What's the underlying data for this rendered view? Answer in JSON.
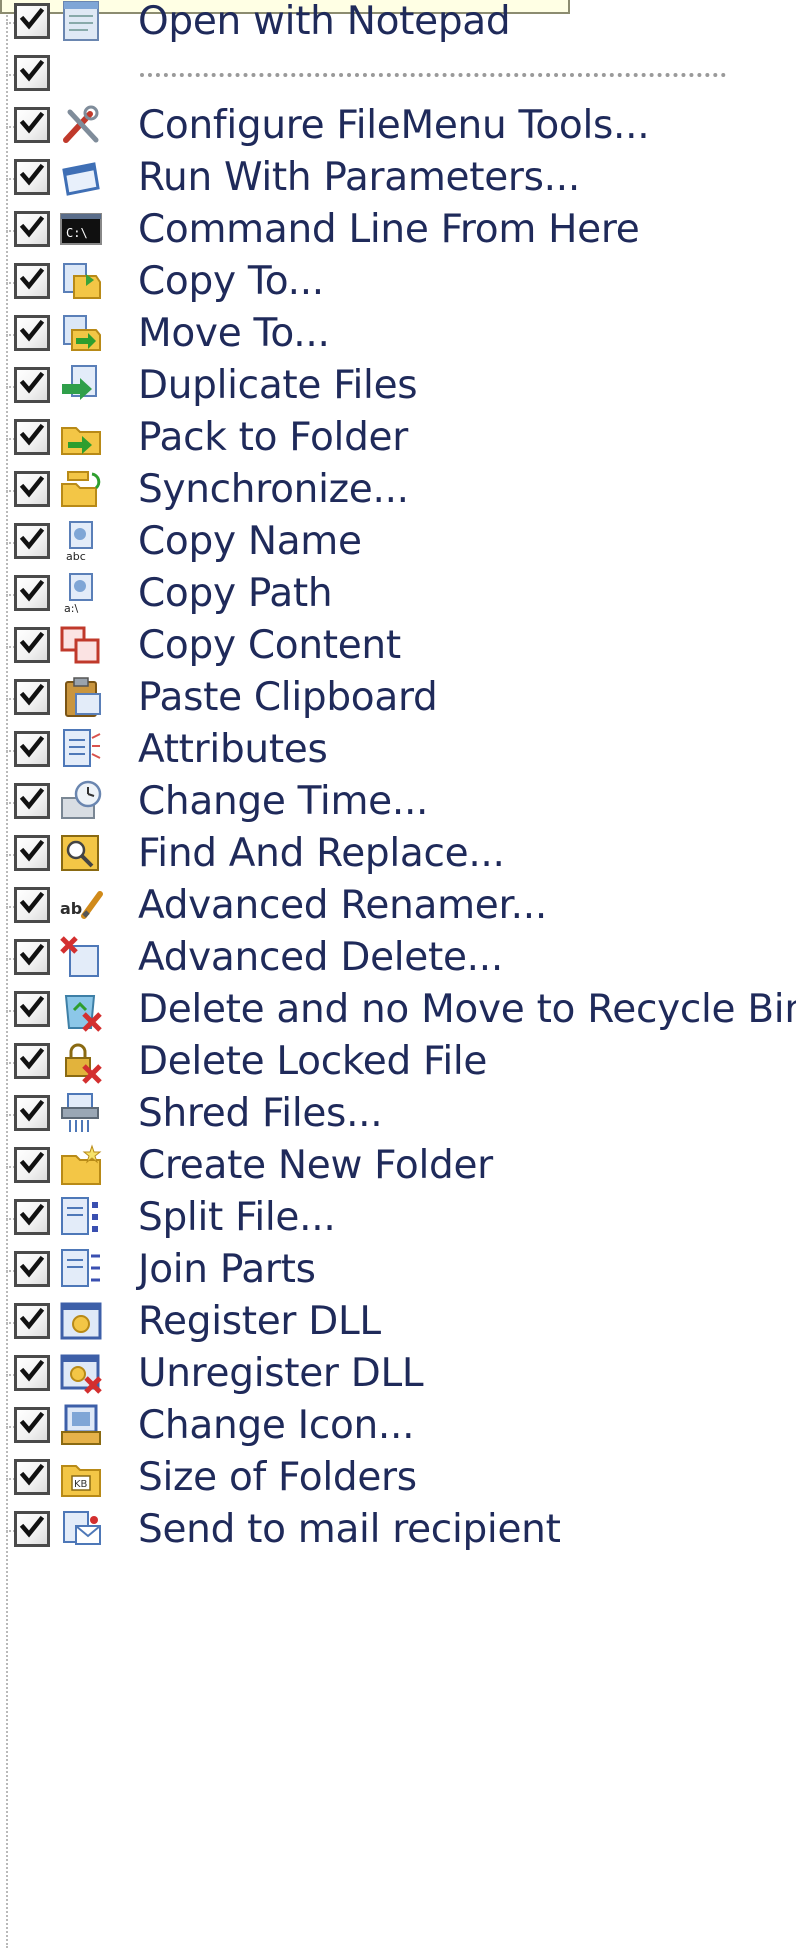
{
  "menu": {
    "items": [
      {
        "label": "Open with Notepad",
        "checked": true,
        "icon": "notepad-icon"
      },
      {
        "label": "",
        "checked": true,
        "icon": "",
        "separator": true
      },
      {
        "label": "Configure FileMenu Tools...",
        "checked": true,
        "icon": "tools-icon"
      },
      {
        "label": "Run With Parameters...",
        "checked": true,
        "icon": "run-window-icon"
      },
      {
        "label": "Command Line From Here",
        "checked": true,
        "icon": "command-prompt-icon"
      },
      {
        "label": "Copy To...",
        "checked": true,
        "icon": "copy-to-folder-icon"
      },
      {
        "label": "Move To...",
        "checked": true,
        "icon": "move-to-folder-icon"
      },
      {
        "label": "Duplicate Files",
        "checked": true,
        "icon": "duplicate-files-icon"
      },
      {
        "label": "Pack to Folder",
        "checked": true,
        "icon": "pack-folder-icon"
      },
      {
        "label": "Synchronize...",
        "checked": true,
        "icon": "synchronize-icon"
      },
      {
        "label": "Copy Name",
        "checked": true,
        "icon": "copy-name-icon"
      },
      {
        "label": "Copy Path",
        "checked": true,
        "icon": "copy-path-icon"
      },
      {
        "label": "Copy Content",
        "checked": true,
        "icon": "copy-content-icon"
      },
      {
        "label": "Paste Clipboard",
        "checked": true,
        "icon": "paste-clipboard-icon"
      },
      {
        "label": "Attributes",
        "checked": true,
        "icon": "attributes-icon"
      },
      {
        "label": "Change Time...",
        "checked": true,
        "icon": "change-time-icon"
      },
      {
        "label": "Find And Replace...",
        "checked": true,
        "icon": "find-replace-icon"
      },
      {
        "label": "Advanced Renamer...",
        "checked": true,
        "icon": "renamer-icon"
      },
      {
        "label": "Advanced Delete...",
        "checked": true,
        "icon": "advanced-delete-icon"
      },
      {
        "label": "Delete and no Move to Recycle Bin",
        "checked": true,
        "icon": "delete-no-recycle-icon"
      },
      {
        "label": "Delete Locked File",
        "checked": true,
        "icon": "delete-locked-icon"
      },
      {
        "label": "Shred Files...",
        "checked": true,
        "icon": "shred-files-icon"
      },
      {
        "label": "Create New Folder",
        "checked": true,
        "icon": "new-folder-icon"
      },
      {
        "label": "Split File...",
        "checked": true,
        "icon": "split-file-icon"
      },
      {
        "label": "Join Parts",
        "checked": true,
        "icon": "join-parts-icon"
      },
      {
        "label": "Register DLL",
        "checked": true,
        "icon": "register-dll-icon"
      },
      {
        "label": "Unregister DLL",
        "checked": true,
        "icon": "unregister-dll-icon"
      },
      {
        "label": "Change Icon...",
        "checked": true,
        "icon": "change-icon-icon"
      },
      {
        "label": "Size of Folders",
        "checked": true,
        "icon": "folder-size-icon"
      },
      {
        "label": "Send to mail recipient",
        "checked": true,
        "icon": "mail-recipient-icon"
      }
    ]
  },
  "colors": {
    "text": "#1f2a5a",
    "checkbox_border": "#4a4a4a",
    "tree_line": "#b9b9b9",
    "tooltip_bg": "#ffffe4"
  }
}
